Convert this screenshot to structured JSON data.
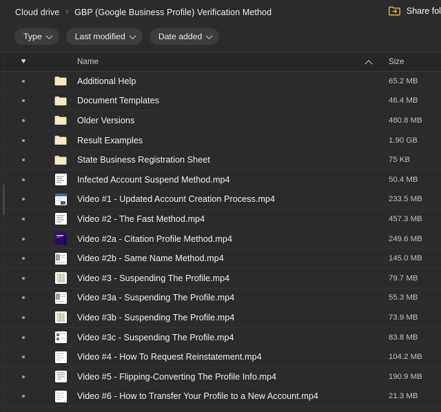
{
  "header": {
    "breadcrumb": {
      "root": "Cloud drive",
      "separator": "›",
      "current": "GBP (Google Business Profile) Verification Method"
    },
    "share": {
      "label": "Share folder",
      "icon": "share-folder-icon"
    }
  },
  "filters": [
    {
      "label": "Type",
      "icon": "chevron-down-icon"
    },
    {
      "label": "Last modified",
      "icon": "chevron-down-icon"
    },
    {
      "label": "Date added",
      "icon": "chevron-down-icon"
    }
  ],
  "table": {
    "columns": {
      "favorite": "heart-icon",
      "name": "Name",
      "sort": "chevron-up-icon",
      "size": "Size"
    },
    "rows": [
      {
        "name": "Additional Help",
        "size": "65.2 MB",
        "kind": "folder",
        "icon": "folder-icon"
      },
      {
        "name": "Document Templates",
        "size": "46.4 MB",
        "kind": "folder",
        "icon": "folder-icon"
      },
      {
        "name": "Older Versions",
        "size": "480.8 MB",
        "kind": "folder",
        "icon": "folder-icon"
      },
      {
        "name": "Result Examples",
        "size": "1.90 GB",
        "kind": "folder",
        "icon": "folder-icon"
      },
      {
        "name": "State Business Registration Sheet",
        "size": "75 KB",
        "kind": "folder",
        "icon": "folder-icon"
      },
      {
        "name": "Infected Account Suspend Method.mp4",
        "size": "50.4 MB",
        "kind": "tv-doc",
        "icon": "video-thumbnail"
      },
      {
        "name": "Video #1 - Updated Account Creation Process.mp4",
        "size": "233.5 MB",
        "kind": "tv-win",
        "icon": "video-thumbnail"
      },
      {
        "name": "Video #2 - The Fast Method.mp4",
        "size": "457.3 MB",
        "kind": "tv-doc",
        "icon": "video-thumbnail"
      },
      {
        "name": "Video #2a - Citation Profile Method.mp4",
        "size": "249.6 MB",
        "kind": "tv-purple",
        "icon": "video-thumbnail"
      },
      {
        "name": "Video #2b - Same Name Method.mp4",
        "size": "145.0 MB",
        "kind": "tv-blk",
        "icon": "video-thumbnail"
      },
      {
        "name": "Video #3 - Suspending The Profile.mp4",
        "size": "79.7 MB",
        "kind": "tv-cols",
        "icon": "video-thumbnail"
      },
      {
        "name": "Video #3a - Suspending The Profile.mp4",
        "size": "55.3 MB",
        "kind": "tv-blk",
        "icon": "video-thumbnail"
      },
      {
        "name": "Video #3b - Suspending The Profile.mp4",
        "size": "73.9 MB",
        "kind": "tv-cols",
        "icon": "video-thumbnail"
      },
      {
        "name": "Video #3c - Suspending The Profile.mp4",
        "size": "83.8 MB",
        "kind": "tv-grid",
        "icon": "video-thumbnail"
      },
      {
        "name": "Video #4 - How To Request Reinstatement.mp4",
        "size": "104.2 MB",
        "kind": "tv-doc",
        "icon": "video-thumbnail"
      },
      {
        "name": "Video #5 - Flipping-Converting The Profile Info.mp4",
        "size": "190.9 MB",
        "kind": "tv-page",
        "icon": "video-thumbnail"
      },
      {
        "name": "Video #6 - How to Transfer Your Profile to a New Account.mp4",
        "size": "21.3 MB",
        "kind": "tv-doc",
        "icon": "video-thumbnail"
      }
    ]
  },
  "colors": {
    "background": "#2b2b2b",
    "header_row": "#272727",
    "row_divider": "#333333",
    "chip": "#3c3c3c",
    "folder": "#f0e2b8",
    "text_primary": "#f0f0f0",
    "text_secondary": "#c2c2c2"
  }
}
